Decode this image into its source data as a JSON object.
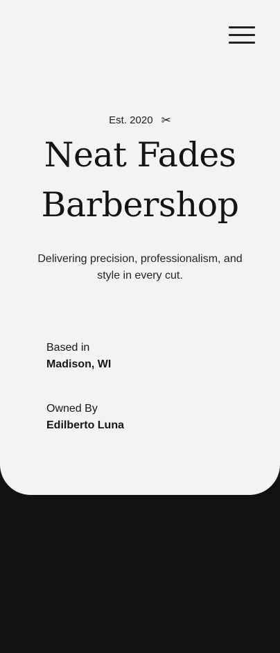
{
  "menu": {
    "icon": "hamburger-menu-icon"
  },
  "hero": {
    "established": "Est. 2020",
    "established_icon": "scissors-icon",
    "title_line1": "Neat Fades",
    "title_line2": "Barbershop",
    "tagline": "Delivering precision, professionalism, and style in every cut."
  },
  "details": {
    "based_label": "Based in",
    "based_value": "Madison, WI",
    "owner_label": "Owned By",
    "owner_value": "Edilberto Luna"
  },
  "colors": {
    "card_background": "#f5f3f1",
    "page_background": "#121110",
    "text": "#141414"
  }
}
